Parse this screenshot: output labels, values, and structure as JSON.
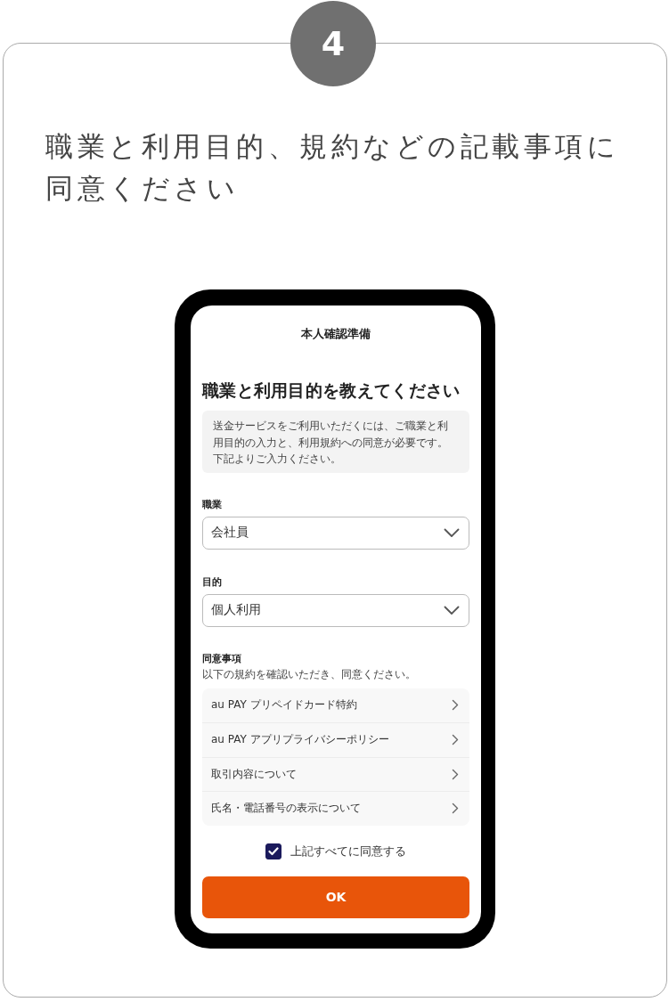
{
  "step": "4",
  "instruction": "職業と利用目的、規約などの記載事項に同意ください",
  "screen": {
    "title": "本人確認準備",
    "heading": "職業と利用目的を教えてください",
    "notice": "送金サービスをご利用いただくには、ご職業と利用目的の入力と、利用規約への同意が必要です。下記よりご入力ください。",
    "fields": [
      {
        "label": "職業",
        "value": "会社員"
      },
      {
        "label": "目的",
        "value": "個人利用"
      }
    ],
    "consent": {
      "label": "同意事項",
      "description": "以下の規約を確認いただき、同意ください。",
      "items": [
        {
          "label": "au PAY プリペイドカード特約"
        },
        {
          "label": "au PAY アプリプライバシーポリシー"
        },
        {
          "label": "取引内容について"
        },
        {
          "label": "氏名・電話番号の表示について"
        }
      ],
      "agree": {
        "label": "上記すべてに同意する",
        "checked": true
      }
    },
    "button": "OK"
  }
}
